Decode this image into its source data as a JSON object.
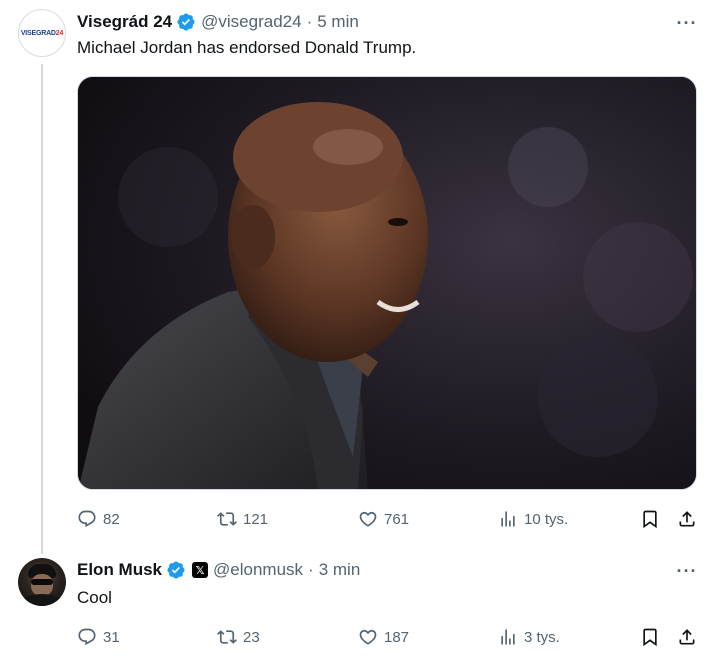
{
  "tweets": [
    {
      "display_name": "Visegrád 24",
      "handle": "@visegrad24",
      "separator": "·",
      "time": "5 min",
      "text": "Michael Jordan has endorsed Donald Trump.",
      "avatar_text_a": "VISEGRAD",
      "avatar_text_b": "24",
      "more": "···",
      "stats": {
        "replies": "82",
        "reposts": "121",
        "likes": "761",
        "views": "10 tys."
      },
      "verified_color": "#1d9bf0"
    },
    {
      "display_name": "Elon Musk",
      "handle": "@elonmusk",
      "separator": "·",
      "time": "3 min",
      "text": "Cool",
      "affiliate_badge": "𝕏",
      "more": "···",
      "stats": {
        "replies": "31",
        "reposts": "23",
        "likes": "187",
        "views": "3 tys."
      },
      "verified_color": "#1d9bf0"
    }
  ],
  "colors": {
    "text": "#0f1419",
    "secondary": "#536471",
    "thread_line": "#cfd9de",
    "accent": "#1d9bf0"
  }
}
